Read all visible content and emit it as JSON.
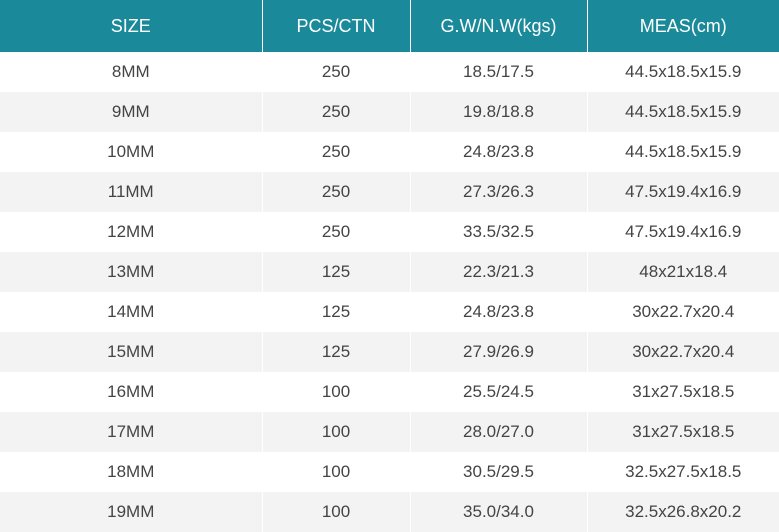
{
  "header": {
    "size": "SIZE",
    "pcs_ctn": "PCS/CTN",
    "weight": "G.W/N.W(kgs)",
    "meas": "MEAS(cm)"
  },
  "colors": {
    "header_bg": "#1a8a9a",
    "header_text": "#ffffff",
    "row_alt_bg": "#f3f3f3",
    "cell_text": "#444444"
  },
  "rows": [
    {
      "size": "8MM",
      "pcs": "250",
      "weight": "18.5/17.5",
      "meas": "44.5x18.5x15.9"
    },
    {
      "size": "9MM",
      "pcs": "250",
      "weight": "19.8/18.8",
      "meas": "44.5x18.5x15.9"
    },
    {
      "size": "10MM",
      "pcs": "250",
      "weight": "24.8/23.8",
      "meas": "44.5x18.5x15.9"
    },
    {
      "size": "11MM",
      "pcs": "250",
      "weight": "27.3/26.3",
      "meas": "47.5x19.4x16.9"
    },
    {
      "size": "12MM",
      "pcs": "250",
      "weight": "33.5/32.5",
      "meas": "47.5x19.4x16.9"
    },
    {
      "size": "13MM",
      "pcs": "125",
      "weight": "22.3/21.3",
      "meas": "48x21x18.4"
    },
    {
      "size": "14MM",
      "pcs": "125",
      "weight": "24.8/23.8",
      "meas": "30x22.7x20.4"
    },
    {
      "size": "15MM",
      "pcs": "125",
      "weight": "27.9/26.9",
      "meas": "30x22.7x20.4"
    },
    {
      "size": "16MM",
      "pcs": "100",
      "weight": "25.5/24.5",
      "meas": "31x27.5x18.5"
    },
    {
      "size": "17MM",
      "pcs": "100",
      "weight": "28.0/27.0",
      "meas": "31x27.5x18.5"
    },
    {
      "size": "18MM",
      "pcs": "100",
      "weight": "30.5/29.5",
      "meas": "32.5x27.5x18.5"
    },
    {
      "size": "19MM",
      "pcs": "100",
      "weight": "35.0/34.0",
      "meas": "32.5x26.8x20.2"
    }
  ]
}
